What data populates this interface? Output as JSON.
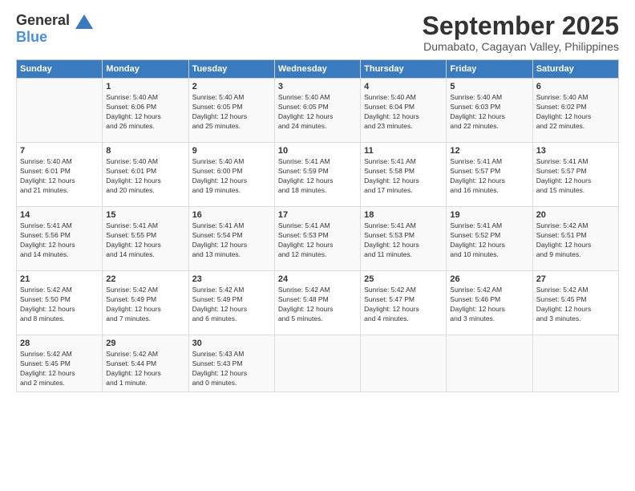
{
  "header": {
    "logo_general": "General",
    "logo_blue": "Blue",
    "month": "September 2025",
    "location": "Dumabato, Cagayan Valley, Philippines"
  },
  "days_of_week": [
    "Sunday",
    "Monday",
    "Tuesday",
    "Wednesday",
    "Thursday",
    "Friday",
    "Saturday"
  ],
  "weeks": [
    [
      {
        "day": "",
        "info": ""
      },
      {
        "day": "1",
        "info": "Sunrise: 5:40 AM\nSunset: 6:06 PM\nDaylight: 12 hours\nand 26 minutes."
      },
      {
        "day": "2",
        "info": "Sunrise: 5:40 AM\nSunset: 6:05 PM\nDaylight: 12 hours\nand 25 minutes."
      },
      {
        "day": "3",
        "info": "Sunrise: 5:40 AM\nSunset: 6:05 PM\nDaylight: 12 hours\nand 24 minutes."
      },
      {
        "day": "4",
        "info": "Sunrise: 5:40 AM\nSunset: 6:04 PM\nDaylight: 12 hours\nand 23 minutes."
      },
      {
        "day": "5",
        "info": "Sunrise: 5:40 AM\nSunset: 6:03 PM\nDaylight: 12 hours\nand 22 minutes."
      },
      {
        "day": "6",
        "info": "Sunrise: 5:40 AM\nSunset: 6:02 PM\nDaylight: 12 hours\nand 22 minutes."
      }
    ],
    [
      {
        "day": "7",
        "info": "Sunrise: 5:40 AM\nSunset: 6:01 PM\nDaylight: 12 hours\nand 21 minutes."
      },
      {
        "day": "8",
        "info": "Sunrise: 5:40 AM\nSunset: 6:01 PM\nDaylight: 12 hours\nand 20 minutes."
      },
      {
        "day": "9",
        "info": "Sunrise: 5:40 AM\nSunset: 6:00 PM\nDaylight: 12 hours\nand 19 minutes."
      },
      {
        "day": "10",
        "info": "Sunrise: 5:41 AM\nSunset: 5:59 PM\nDaylight: 12 hours\nand 18 minutes."
      },
      {
        "day": "11",
        "info": "Sunrise: 5:41 AM\nSunset: 5:58 PM\nDaylight: 12 hours\nand 17 minutes."
      },
      {
        "day": "12",
        "info": "Sunrise: 5:41 AM\nSunset: 5:57 PM\nDaylight: 12 hours\nand 16 minutes."
      },
      {
        "day": "13",
        "info": "Sunrise: 5:41 AM\nSunset: 5:57 PM\nDaylight: 12 hours\nand 15 minutes."
      }
    ],
    [
      {
        "day": "14",
        "info": "Sunrise: 5:41 AM\nSunset: 5:56 PM\nDaylight: 12 hours\nand 14 minutes."
      },
      {
        "day": "15",
        "info": "Sunrise: 5:41 AM\nSunset: 5:55 PM\nDaylight: 12 hours\nand 14 minutes."
      },
      {
        "day": "16",
        "info": "Sunrise: 5:41 AM\nSunset: 5:54 PM\nDaylight: 12 hours\nand 13 minutes."
      },
      {
        "day": "17",
        "info": "Sunrise: 5:41 AM\nSunset: 5:53 PM\nDaylight: 12 hours\nand 12 minutes."
      },
      {
        "day": "18",
        "info": "Sunrise: 5:41 AM\nSunset: 5:53 PM\nDaylight: 12 hours\nand 11 minutes."
      },
      {
        "day": "19",
        "info": "Sunrise: 5:41 AM\nSunset: 5:52 PM\nDaylight: 12 hours\nand 10 minutes."
      },
      {
        "day": "20",
        "info": "Sunrise: 5:42 AM\nSunset: 5:51 PM\nDaylight: 12 hours\nand 9 minutes."
      }
    ],
    [
      {
        "day": "21",
        "info": "Sunrise: 5:42 AM\nSunset: 5:50 PM\nDaylight: 12 hours\nand 8 minutes."
      },
      {
        "day": "22",
        "info": "Sunrise: 5:42 AM\nSunset: 5:49 PM\nDaylight: 12 hours\nand 7 minutes."
      },
      {
        "day": "23",
        "info": "Sunrise: 5:42 AM\nSunset: 5:49 PM\nDaylight: 12 hours\nand 6 minutes."
      },
      {
        "day": "24",
        "info": "Sunrise: 5:42 AM\nSunset: 5:48 PM\nDaylight: 12 hours\nand 5 minutes."
      },
      {
        "day": "25",
        "info": "Sunrise: 5:42 AM\nSunset: 5:47 PM\nDaylight: 12 hours\nand 4 minutes."
      },
      {
        "day": "26",
        "info": "Sunrise: 5:42 AM\nSunset: 5:46 PM\nDaylight: 12 hours\nand 3 minutes."
      },
      {
        "day": "27",
        "info": "Sunrise: 5:42 AM\nSunset: 5:45 PM\nDaylight: 12 hours\nand 3 minutes."
      }
    ],
    [
      {
        "day": "28",
        "info": "Sunrise: 5:42 AM\nSunset: 5:45 PM\nDaylight: 12 hours\nand 2 minutes."
      },
      {
        "day": "29",
        "info": "Sunrise: 5:42 AM\nSunset: 5:44 PM\nDaylight: 12 hours\nand 1 minute."
      },
      {
        "day": "30",
        "info": "Sunrise: 5:43 AM\nSunset: 5:43 PM\nDaylight: 12 hours\nand 0 minutes."
      },
      {
        "day": "",
        "info": ""
      },
      {
        "day": "",
        "info": ""
      },
      {
        "day": "",
        "info": ""
      },
      {
        "day": "",
        "info": ""
      }
    ]
  ]
}
